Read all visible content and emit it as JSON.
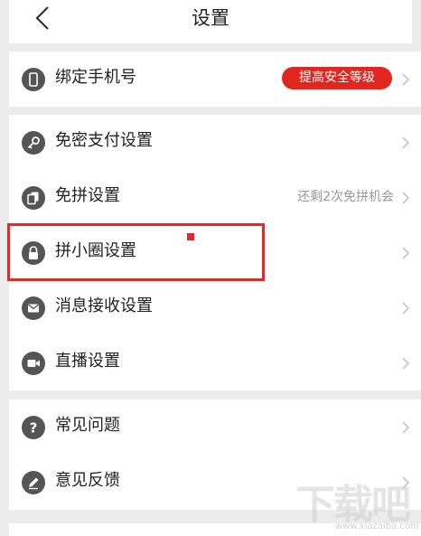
{
  "header": {
    "title": "设置"
  },
  "groups": [
    {
      "items": [
        {
          "label": "绑定手机号",
          "icon": "phone-icon",
          "badge": "提高安全等级"
        }
      ]
    },
    {
      "items": [
        {
          "label": "免密支付设置",
          "icon": "key-icon"
        },
        {
          "label": "免拼设置",
          "icon": "copy-icon",
          "right_text": "还剩2次免拼机会"
        },
        {
          "label": "拼小圈设置",
          "icon": "lock-icon"
        },
        {
          "label": "消息接收设置",
          "icon": "message-icon"
        },
        {
          "label": "直播设置",
          "icon": "video-icon"
        }
      ]
    },
    {
      "items": [
        {
          "label": "常见问题",
          "icon": "help-icon"
        },
        {
          "label": "意见反馈",
          "icon": "feedback-icon"
        }
      ]
    }
  ],
  "watermark": {
    "text": "下载吧",
    "url": "www.xiazaiba.com"
  },
  "colors": {
    "accent": "#e0261e",
    "icon_bg": "#555555",
    "background": "#ececec"
  }
}
